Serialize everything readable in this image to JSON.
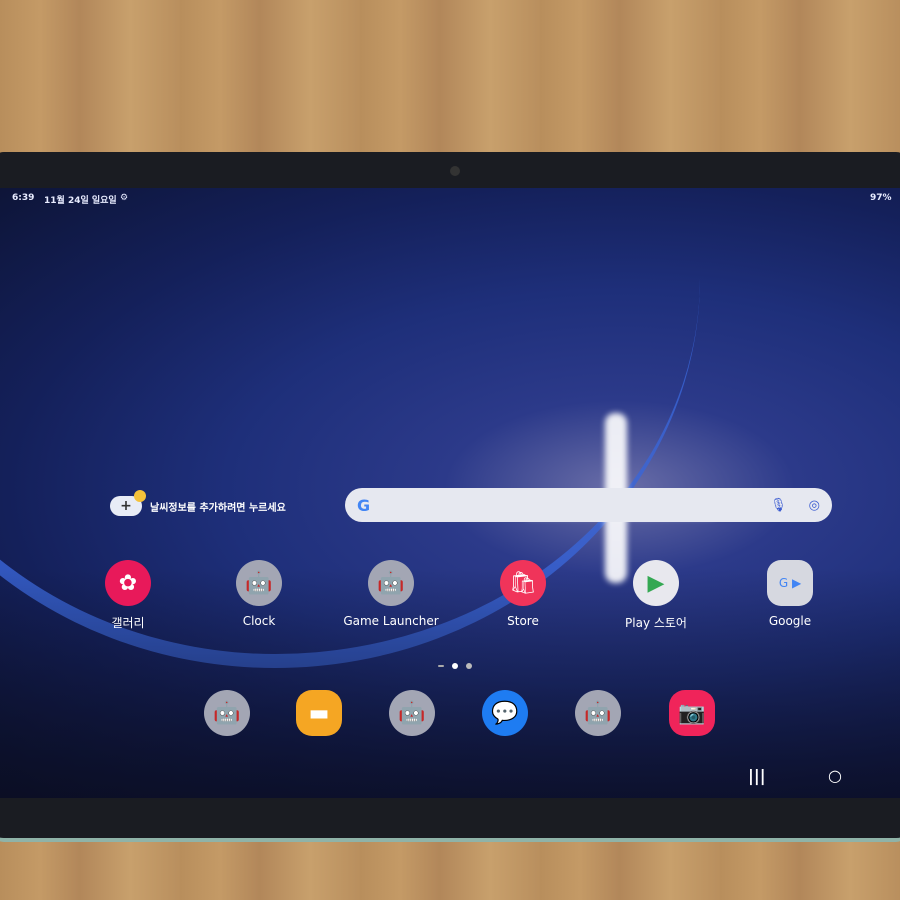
{
  "status_bar": {
    "time": "6:39",
    "date": "11월 24일 일요일",
    "settings_icon": "gear-icon",
    "battery": "97%"
  },
  "weather_widget": {
    "text": "날씨정보를 추가하려면 누르세요",
    "icon": "cloud-sun-plus-icon"
  },
  "search_bar": {
    "logo": "G",
    "mic_icon": "microphone-icon",
    "lens_icon": "lens-icon"
  },
  "apps": [
    {
      "label": "갤러리",
      "icon": "gallery-flower-icon",
      "color": "#e8195a"
    },
    {
      "label": "Clock",
      "icon": "android-icon",
      "color": "#a3a6b4"
    },
    {
      "label": "Game Launcher",
      "icon": "android-icon",
      "color": "#a3a6b4"
    },
    {
      "label": "Store",
      "icon": "shopping-bag-icon",
      "color": "#f0345a"
    },
    {
      "label": "Play 스토어",
      "icon": "play-store-icon",
      "color": "#e8e8ee"
    },
    {
      "label": "Google",
      "icon": "google-folder-icon",
      "color": "#d6d8e0"
    }
  ],
  "page_indicator": {
    "pages": 3,
    "current": 2
  },
  "dock": [
    {
      "icon": "android-icon",
      "color": "#a3a6b4"
    },
    {
      "icon": "folder-icon",
      "color": "#f5a623"
    },
    {
      "icon": "android-icon",
      "color": "#a3a6b4"
    },
    {
      "icon": "messages-icon",
      "color": "#1e7cf2"
    },
    {
      "icon": "android-icon",
      "color": "#a3a6b4"
    },
    {
      "icon": "camera-icon",
      "color": "#f0245a"
    }
  ],
  "nav_bar": {
    "recents": "|||",
    "home": "○"
  }
}
